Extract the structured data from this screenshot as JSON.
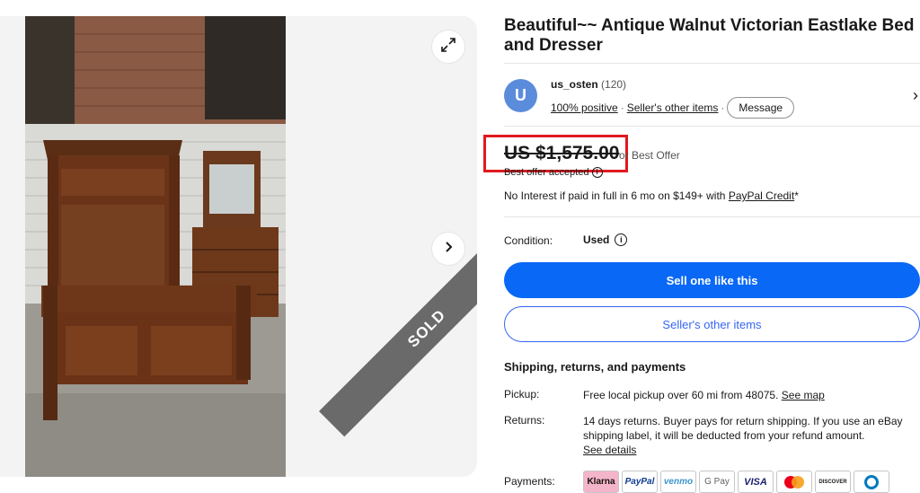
{
  "gallery": {
    "sold_label": "SOLD"
  },
  "listing": {
    "title": "Beautiful~~ Antique Walnut Victorian Eastlake Bed and Dresser"
  },
  "seller": {
    "avatar_letter": "U",
    "name": "us_osten",
    "feedback_count": "(120)",
    "positive": "100% positive",
    "separator": "·",
    "other_items_link": "Seller's other items",
    "message_button": "Message"
  },
  "price": {
    "amount": "US $1,575.00",
    "best_offer_text": "or Best Offer",
    "offer_accepted": "Best offer accepted",
    "financing_text": "No Interest if paid in full in 6 mo on $149+ with ",
    "financing_link": "PayPal Credit",
    "financing_suffix": "*"
  },
  "condition": {
    "label": "Condition:",
    "value": "Used"
  },
  "actions": {
    "primary": "Sell one like this",
    "secondary": "Seller's other items"
  },
  "shipping": {
    "heading": "Shipping, returns, and payments",
    "pickup_label": "Pickup:",
    "pickup_text": "Free local pickup over 60 mi from 48075. ",
    "pickup_link": "See map",
    "returns_label": "Returns:",
    "returns_text": "14 days returns. Buyer pays for return shipping. If you use an eBay shipping label, it will be deducted from your refund amount.",
    "returns_link": "See details",
    "payments_label": "Payments:"
  },
  "payment_methods": {
    "klarna": "Klarna",
    "paypal": "PayPal",
    "venmo": "venmo",
    "gpay": "G Pay",
    "visa": "VISA",
    "discover": "DISCOVER"
  },
  "colors": {
    "accent_blue": "#0968f6",
    "link_blue": "#3665f3",
    "highlight_red": "#e0191e",
    "avatar_blue": "#5b8cdb"
  }
}
